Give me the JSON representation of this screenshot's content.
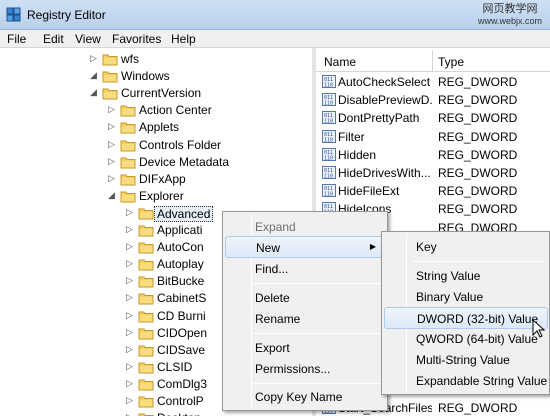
{
  "window": {
    "title": "Registry Editor",
    "watermark_line1": "网页教学网",
    "watermark_line2": "www.webjx.com"
  },
  "menubar": [
    "File",
    "Edit",
    "View",
    "Favorites",
    "Help"
  ],
  "tree": {
    "items": [
      {
        "label": "wfs",
        "expanded": false
      },
      {
        "label": "Windows",
        "expanded": true
      },
      {
        "label": "CurrentVersion",
        "expanded": true
      },
      {
        "label": "Action Center",
        "expanded": false
      },
      {
        "label": "Applets",
        "expanded": false
      },
      {
        "label": "Controls Folder",
        "expanded": false
      },
      {
        "label": "Device Metadata",
        "expanded": false
      },
      {
        "label": "DIFxApp",
        "expanded": false
      },
      {
        "label": "Explorer",
        "expanded": true
      },
      {
        "label": "Advanced",
        "expanded": false,
        "selected": true
      },
      {
        "label": "Applicati",
        "expanded": false
      },
      {
        "label": "AutoCon",
        "expanded": false
      },
      {
        "label": "Autoplay",
        "expanded": false
      },
      {
        "label": "BitBucke",
        "expanded": false
      },
      {
        "label": "CabinetS",
        "expanded": false
      },
      {
        "label": "CD Burni",
        "expanded": false
      },
      {
        "label": "CIDOpen",
        "expanded": false
      },
      {
        "label": "CIDSave",
        "expanded": false
      },
      {
        "label": "CLSID",
        "expanded": false
      },
      {
        "label": "ComDlg3",
        "expanded": false
      },
      {
        "label": "ControlP",
        "expanded": false
      },
      {
        "label": "Desktop",
        "expanded": false
      }
    ]
  },
  "values_pane": {
    "headers": {
      "name": "Name",
      "type": "Type"
    },
    "rows": [
      {
        "name": "AutoCheckSelect",
        "type": "REG_DWORD"
      },
      {
        "name": "DisablePreviewD...",
        "type": "REG_DWORD"
      },
      {
        "name": "DontPrettyPath",
        "type": "REG_DWORD"
      },
      {
        "name": "Filter",
        "type": "REG_DWORD"
      },
      {
        "name": "Hidden",
        "type": "REG_DWORD"
      },
      {
        "name": "HideDrivesWith...",
        "type": "REG_DWORD"
      },
      {
        "name": "HideFileExt",
        "type": "REG_DWORD"
      },
      {
        "name": "HideIcons",
        "type": "REG_DWORD"
      },
      {
        "name": "",
        "type": "REG_DWORD"
      },
      {
        "name": "Start_SearchFiles",
        "type": "REG_DWORD"
      }
    ]
  },
  "context_menu": {
    "items": [
      "Expand",
      "New",
      "Find...",
      "Delete",
      "Rename",
      "Export",
      "Permissions...",
      "Copy Key Name"
    ]
  },
  "new_submenu": {
    "items": [
      "Key",
      "String Value",
      "Binary Value",
      "DWORD (32-bit) Value",
      "QWORD (64-bit) Value",
      "Multi-String Value",
      "Expandable String Value"
    ]
  }
}
